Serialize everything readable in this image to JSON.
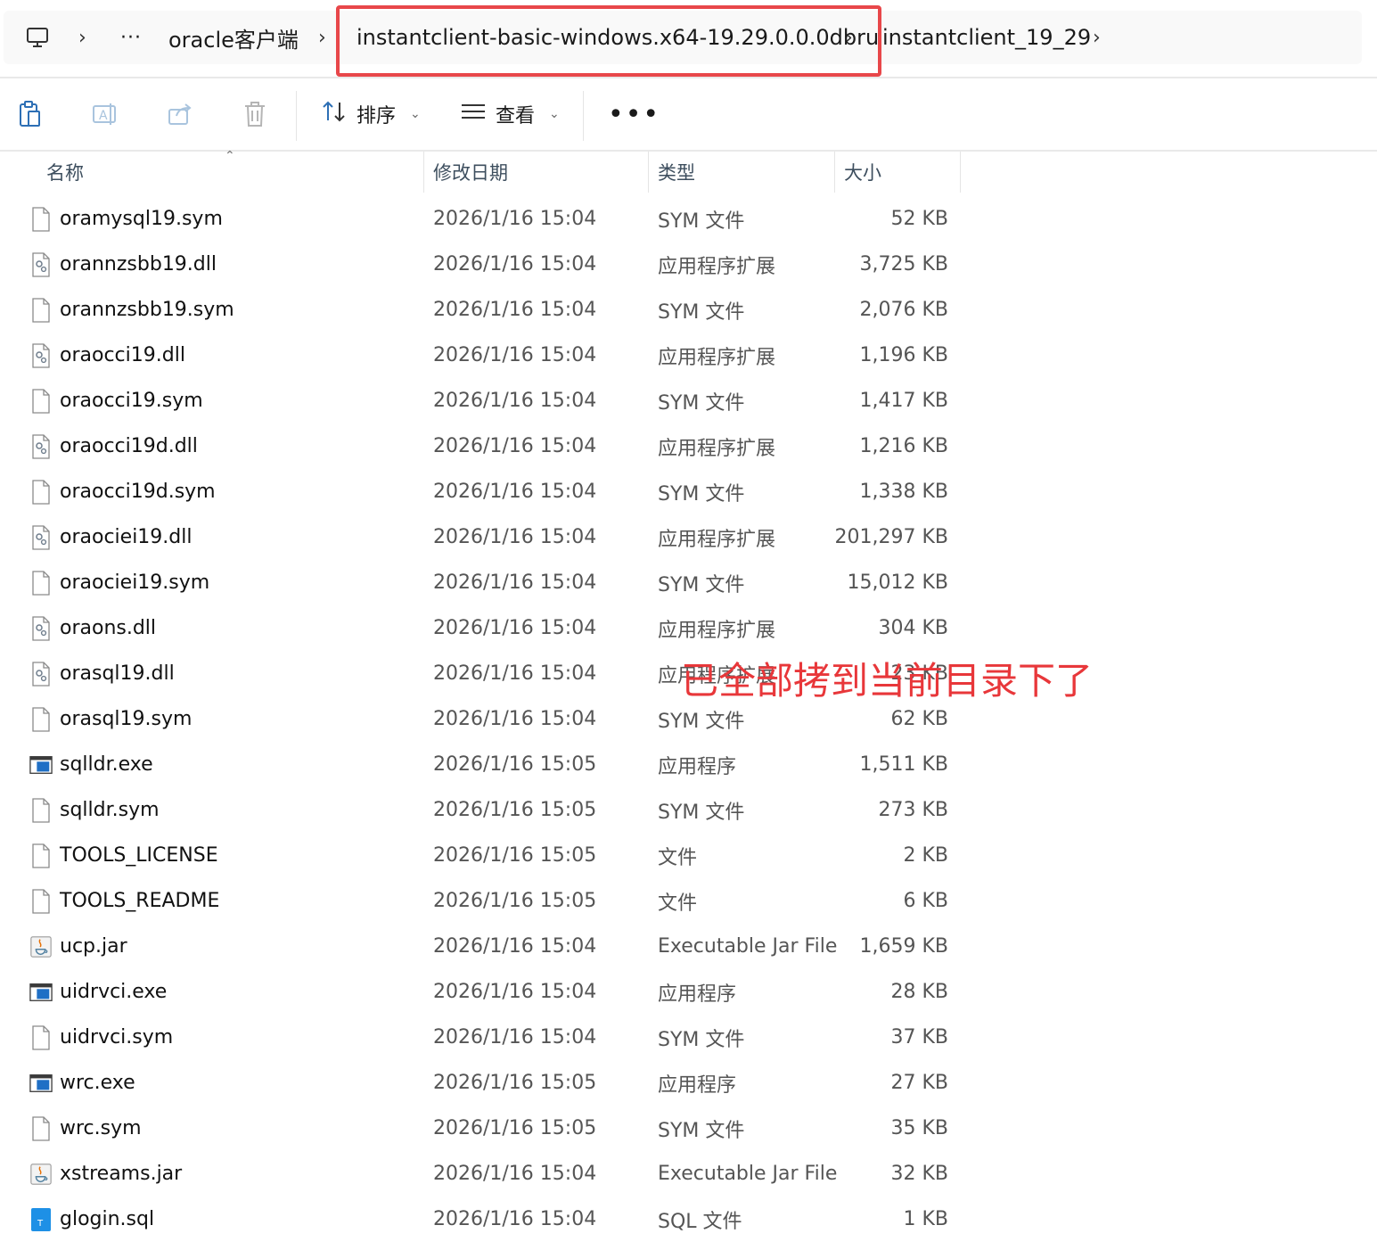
{
  "address": {
    "computer_icon": "computer-icon",
    "ellipsis": "···",
    "crumbs": [
      "oracle客户端",
      "instantclient-basic-windows.x64-19.29.0.0.0dbru",
      "instantclient_19_29"
    ]
  },
  "toolbar": {
    "sort_label": "排序",
    "view_label": "查看",
    "more_label": "•••"
  },
  "columns": {
    "name": "名称",
    "date": "修改日期",
    "type": "类型",
    "size": "大小"
  },
  "files": [
    {
      "name": "oramysql19.sym",
      "date": "2026/1/16 15:04",
      "type": "SYM 文件",
      "size": "52 KB",
      "icon": "generic-file-icon"
    },
    {
      "name": "orannzsbb19.dll",
      "date": "2026/1/16 15:04",
      "type": "应用程序扩展",
      "size": "3,725 KB",
      "icon": "dll-file-icon"
    },
    {
      "name": "orannzsbb19.sym",
      "date": "2026/1/16 15:04",
      "type": "SYM 文件",
      "size": "2,076 KB",
      "icon": "generic-file-icon"
    },
    {
      "name": "oraocci19.dll",
      "date": "2026/1/16 15:04",
      "type": "应用程序扩展",
      "size": "1,196 KB",
      "icon": "dll-file-icon"
    },
    {
      "name": "oraocci19.sym",
      "date": "2026/1/16 15:04",
      "type": "SYM 文件",
      "size": "1,417 KB",
      "icon": "generic-file-icon"
    },
    {
      "name": "oraocci19d.dll",
      "date": "2026/1/16 15:04",
      "type": "应用程序扩展",
      "size": "1,216 KB",
      "icon": "dll-file-icon"
    },
    {
      "name": "oraocci19d.sym",
      "date": "2026/1/16 15:04",
      "type": "SYM 文件",
      "size": "1,338 KB",
      "icon": "generic-file-icon"
    },
    {
      "name": "oraociei19.dll",
      "date": "2026/1/16 15:04",
      "type": "应用程序扩展",
      "size": "201,297 KB",
      "icon": "dll-file-icon"
    },
    {
      "name": "oraociei19.sym",
      "date": "2026/1/16 15:04",
      "type": "SYM 文件",
      "size": "15,012 KB",
      "icon": "generic-file-icon"
    },
    {
      "name": "oraons.dll",
      "date": "2026/1/16 15:04",
      "type": "应用程序扩展",
      "size": "304 KB",
      "icon": "dll-file-icon"
    },
    {
      "name": "orasql19.dll",
      "date": "2026/1/16 15:04",
      "type": "应用程序扩展",
      "size": "23 KB",
      "icon": "dll-file-icon"
    },
    {
      "name": "orasql19.sym",
      "date": "2026/1/16 15:04",
      "type": "SYM 文件",
      "size": "62 KB",
      "icon": "generic-file-icon"
    },
    {
      "name": "sqlldr.exe",
      "date": "2026/1/16 15:05",
      "type": "应用程序",
      "size": "1,511 KB",
      "icon": "exe-file-icon"
    },
    {
      "name": "sqlldr.sym",
      "date": "2026/1/16 15:05",
      "type": "SYM 文件",
      "size": "273 KB",
      "icon": "generic-file-icon"
    },
    {
      "name": "TOOLS_LICENSE",
      "date": "2026/1/16 15:05",
      "type": "文件",
      "size": "2 KB",
      "icon": "generic-file-icon"
    },
    {
      "name": "TOOLS_README",
      "date": "2026/1/16 15:05",
      "type": "文件",
      "size": "6 KB",
      "icon": "generic-file-icon"
    },
    {
      "name": "ucp.jar",
      "date": "2026/1/16 15:04",
      "type": "Executable Jar File",
      "size": "1,659 KB",
      "icon": "jar-file-icon"
    },
    {
      "name": "uidrvci.exe",
      "date": "2026/1/16 15:04",
      "type": "应用程序",
      "size": "28 KB",
      "icon": "exe-file-icon"
    },
    {
      "name": "uidrvci.sym",
      "date": "2026/1/16 15:04",
      "type": "SYM 文件",
      "size": "37 KB",
      "icon": "generic-file-icon"
    },
    {
      "name": "wrc.exe",
      "date": "2026/1/16 15:05",
      "type": "应用程序",
      "size": "27 KB",
      "icon": "exe-file-icon"
    },
    {
      "name": "wrc.sym",
      "date": "2026/1/16 15:05",
      "type": "SYM 文件",
      "size": "35 KB",
      "icon": "generic-file-icon"
    },
    {
      "name": "xstreams.jar",
      "date": "2026/1/16 15:04",
      "type": "Executable Jar File",
      "size": "32 KB",
      "icon": "jar-file-icon"
    },
    {
      "name": "glogin.sql",
      "date": "2026/1/16 15:04",
      "type": "SQL 文件",
      "size": "1 KB",
      "icon": "sql-file-icon"
    }
  ],
  "annotation": {
    "text": "已全部拷到当前目录下了",
    "color": "#e8373a"
  },
  "colors": {
    "highlight_border": "#e8474a",
    "exe_blue": "#1f6fc5",
    "sql_blue": "#1e90e6"
  }
}
